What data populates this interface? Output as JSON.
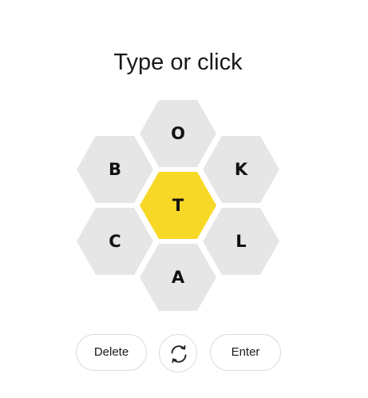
{
  "prompt": "Type or click",
  "letters": {
    "center": "T",
    "top": "O",
    "upper_left": "B",
    "upper_right": "K",
    "lower_left": "C",
    "lower_right": "L",
    "bottom": "A"
  },
  "controls": {
    "delete_label": "Delete",
    "shuffle_icon": "shuffle-icon",
    "enter_label": "Enter"
  },
  "colors": {
    "center_hex": "#f8d826",
    "outer_hex": "#e6e6e6"
  }
}
